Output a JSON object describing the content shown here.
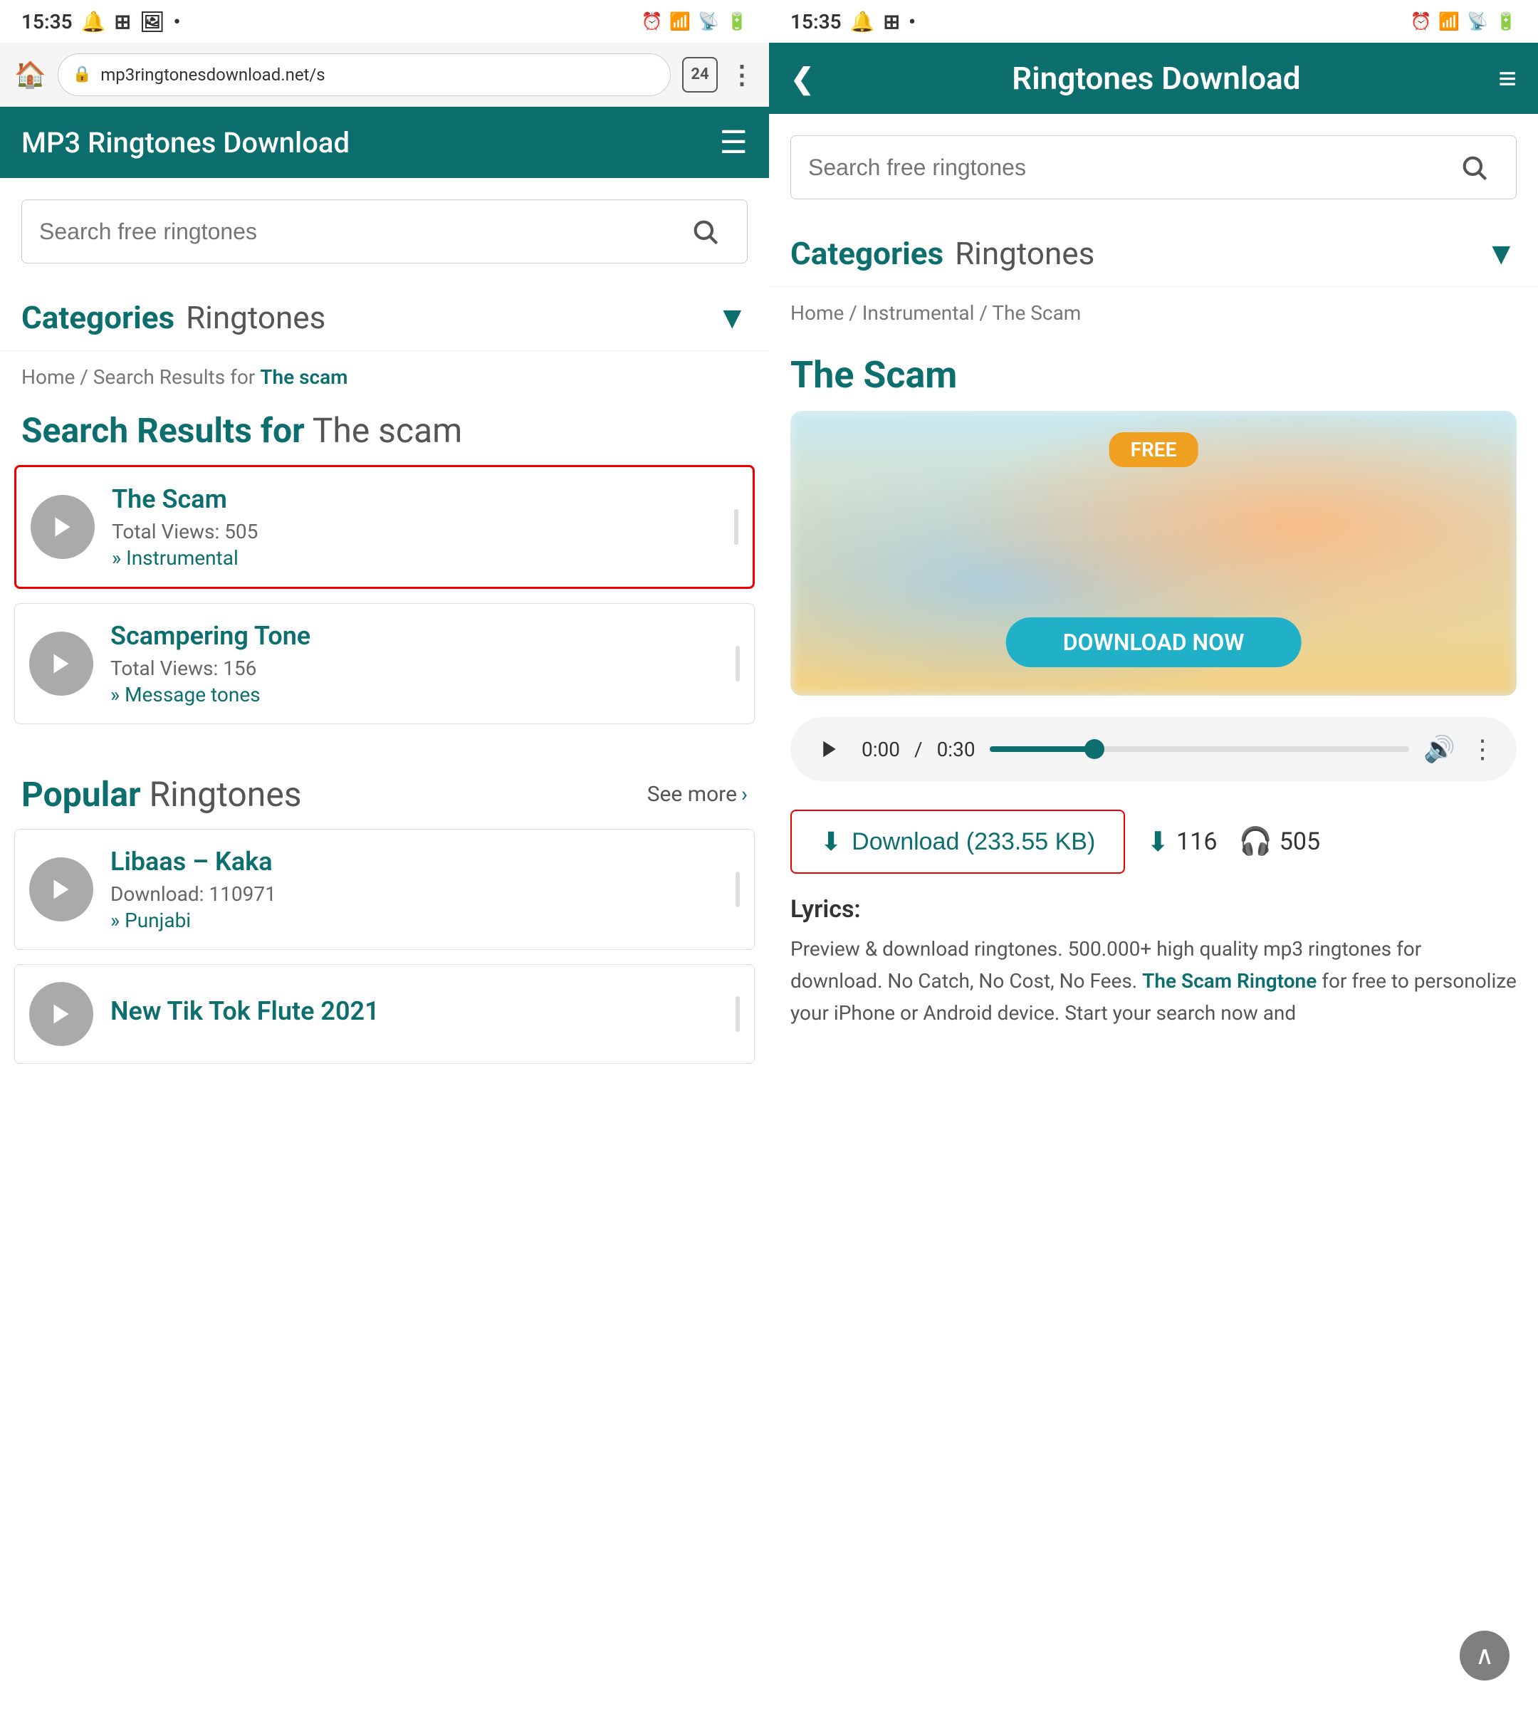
{
  "left": {
    "status_bar": {
      "time": "15:35",
      "icons": [
        "notification",
        "grid",
        "image",
        "dot"
      ]
    },
    "browser": {
      "url": "mp3ringtonesdownload.net/s",
      "tab_count": "24"
    },
    "app": {
      "title": "MP3 Ringtones Download",
      "menu_icon": "☰"
    },
    "search": {
      "placeholder": "Search free ringtones",
      "button_label": "search"
    },
    "categories": {
      "label": "Categories",
      "sub_label": "Ringtones",
      "chevron": "▼"
    },
    "breadcrumb": "Home / Search Results for The scam",
    "search_results_heading": {
      "bold": "Search Results for",
      "light": "The scam"
    },
    "results": [
      {
        "title": "The Scam",
        "views_label": "Total Views:",
        "views": "505",
        "category": "Instrumental",
        "selected": true
      },
      {
        "title": "Scampering Tone",
        "views_label": "Total Views:",
        "views": "156",
        "category": "Message tones",
        "selected": false
      }
    ],
    "popular": {
      "bold": "Popular",
      "light": "Ringtones",
      "see_more": "See more",
      "items": [
        {
          "title": "Libaas – Kaka",
          "stat_label": "Download:",
          "stat_value": "110971",
          "category": "Punjabi"
        },
        {
          "title": "New Tik Tok Flute 2021",
          "stat_label": "",
          "stat_value": "",
          "category": ""
        }
      ]
    }
  },
  "right": {
    "status_bar": {
      "time": "15:35",
      "icons": [
        "notification",
        "grid",
        "dot"
      ]
    },
    "header": {
      "back_label": "❮",
      "title": "Ringtones Download",
      "menu_icon": "≡"
    },
    "search": {
      "placeholder": "Search free ringtones",
      "button_label": "search"
    },
    "categories": {
      "label": "Categories",
      "sub_label": "Ringtones",
      "chevron": "▼"
    },
    "breadcrumb": "Home / Instrumental / The Scam",
    "page_title": "The Scam",
    "player": {
      "time_current": "0:00",
      "time_total": "0:30",
      "progress_percent": 25
    },
    "download": {
      "button_label": "Download (233.55 KB)",
      "stat1_value": "116",
      "stat2_value": "505"
    },
    "lyrics": {
      "label": "Lyrics:",
      "text_before": "Preview & download ringtones. 500.000+ high quality mp3 ringtones for download. No Catch, No Cost, No Fees. ",
      "highlight": "The Scam Ringtone",
      "text_after": " for free to personolize your iPhone or Android device. Start your search now and"
    }
  }
}
